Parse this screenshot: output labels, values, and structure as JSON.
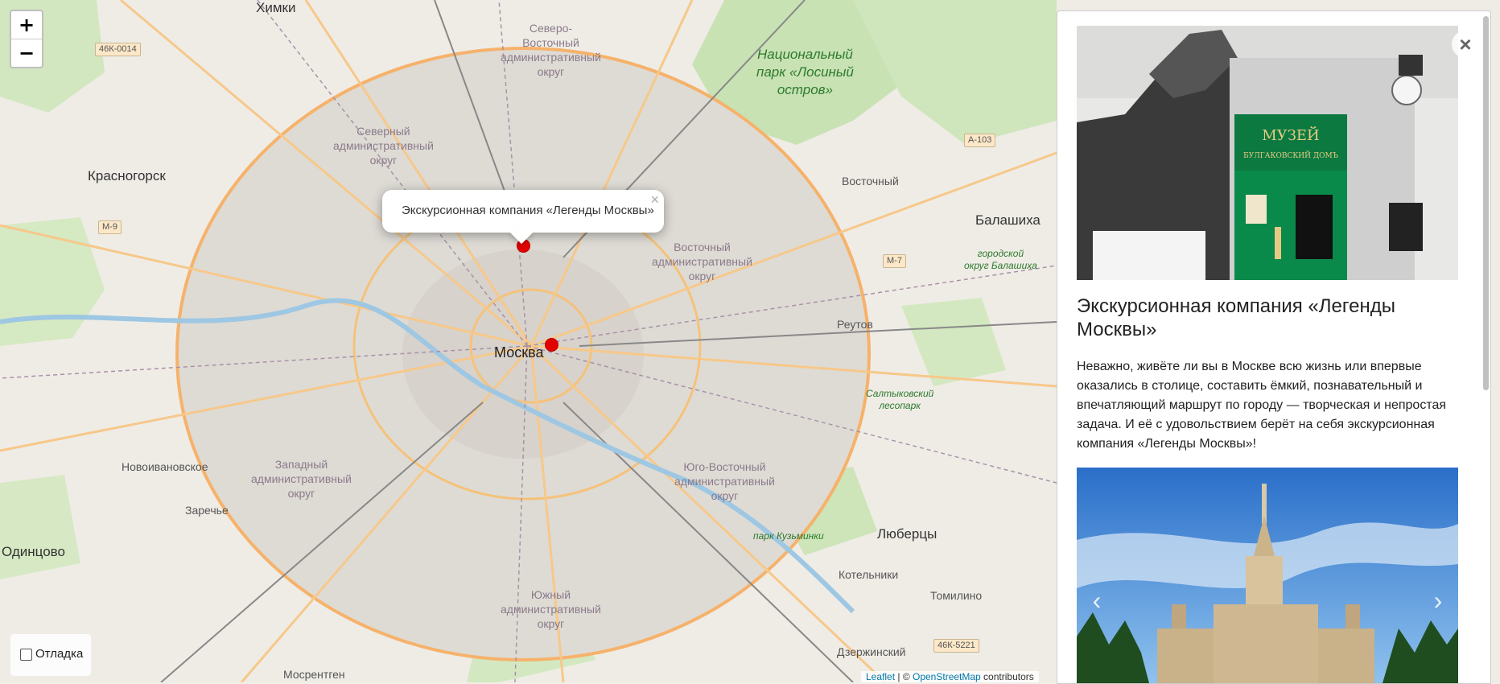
{
  "map": {
    "zoom_in_label": "+",
    "zoom_out_label": "−",
    "popup_text": "Экскурсионная компания «Легенды Москвы»",
    "popup_close": "×",
    "debug_label": "Отладка",
    "attribution": {
      "leaflet": "Leaflet",
      "separator": " | © ",
      "osm": "OpenStreetMap",
      "suffix": " contributors"
    },
    "labels": {
      "moscow": "Москва",
      "khimki": "Химки",
      "krasnogorsk": "Красногорск",
      "balashikha": "Балашиха",
      "vostochny": "Восточный",
      "reutov": "Реутов",
      "novoivanovskoe": "Новоивановское",
      "zarechye": "Заречье",
      "odintsovo": "Одинцово",
      "lyubertsy": "Люберцы",
      "kotelniki": "Котельники",
      "tomilino": "Томилино",
      "dzerzhinsky": "Дзержинский",
      "mosrentgen": "Мосрентген",
      "park_losiny": "Национальный\nпарк «Лосиный\nостров»",
      "park_kuzminki": "парк Кузьминки",
      "saltykovsky": "Салтыковский\nлесопарк",
      "balashikha_okrug": "городской\nокруг Балашиха",
      "d_north_east": "Северо-\nВосточный\nадминистративный\nокруг",
      "d_north": "Северный\nадминистративный\nокруг",
      "d_east": "Восточный\nадминистративный\nокруг",
      "d_west": "Западный\nадминистративный\nокруг",
      "d_south_east": "Юго-Восточный\nадминистративный\nокруг",
      "d_south": "Южный\nадминистративный\nокруг",
      "r_46k0014": "46К-0014",
      "r_m9": "М-9",
      "r_m7": "М-7",
      "r_a103": "А-103",
      "r_46k5221": "46К-5221"
    }
  },
  "panel": {
    "close_label": "×",
    "title": "Экскурсионная компания «Легенды Москвы»",
    "description": "Неважно, живёте ли вы в Москве всю жизнь или впервые оказались в столице, составить ёмкий, познавательный и впечатляющий маршрут по городу — творческая и непростая задача. И её с удовольствием берёт на себя экскурсионная компания «Легенды Москвы»!",
    "photo1_sign_line1": "МУЗЕЙ",
    "photo1_sign_line2": "БУЛГАКОВСКИЙ ДОМЪ",
    "carousel_prev": "‹",
    "carousel_next": "›"
  }
}
